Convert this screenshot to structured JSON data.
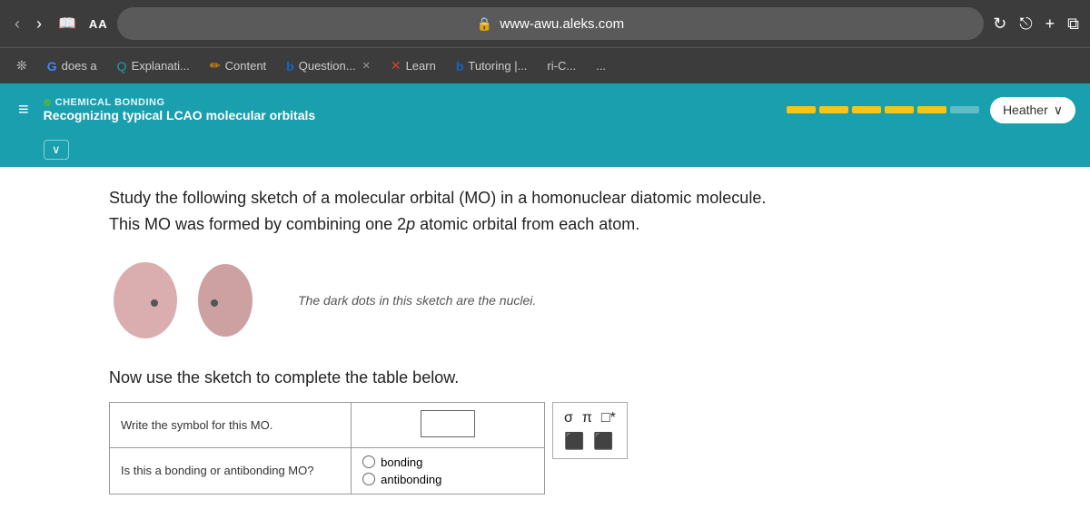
{
  "browser": {
    "url": "www-awu.aleks.com",
    "aa_label": "AA",
    "back_nav": "‹",
    "forward_nav": "›",
    "lock_icon": "🔒",
    "refresh_icon": "↻",
    "share_icon": "⎋",
    "add_icon": "+",
    "tabs_icon": "⧉"
  },
  "tabs": [
    {
      "icon": "❊",
      "label": ""
    },
    {
      "icon": "G",
      "label": "does a",
      "close": false
    },
    {
      "icon": "Q",
      "label": "Explanati...",
      "close": false
    },
    {
      "icon": "✏",
      "label": "Content",
      "close": false
    },
    {
      "icon": "b",
      "label": "Question...",
      "close": "✕"
    },
    {
      "icon": "✕",
      "label": "Learn",
      "close": false
    },
    {
      "icon": "b",
      "label": "Tutoring |...",
      "close": false
    },
    {
      "icon": "",
      "label": "ri-C...",
      "close": false
    },
    {
      "icon": "…",
      "label": "",
      "close": false
    }
  ],
  "header": {
    "section_label": "CHEMICAL BONDING",
    "topic_title": "Recognizing typical LCAO molecular orbitals",
    "user_name": "Heather",
    "progress_filled": 5,
    "progress_empty": 1,
    "dropdown_arrow": "∨"
  },
  "question": {
    "text_part1": "Study the following sketch of a molecular orbital (MO) in a homonuclear diatomic molecule.",
    "text_part2": "This MO was formed by combining one 2",
    "italic_part": "p",
    "text_part3": " atomic orbital from each atom.",
    "orbital_caption": "The dark dots in this sketch are the nuclei.",
    "complete_table_text": "Now use the sketch to complete the table below.",
    "table": {
      "row1_label": "Write the symbol for this MO.",
      "row2_label": "Is this a bonding or antibonding MO?",
      "row2_option1": "bonding",
      "row2_option2": "antibonding"
    },
    "symbols": {
      "row1": [
        "σ",
        "π",
        "□*"
      ],
      "row2": [
        "⬛",
        "⬛"
      ]
    }
  }
}
